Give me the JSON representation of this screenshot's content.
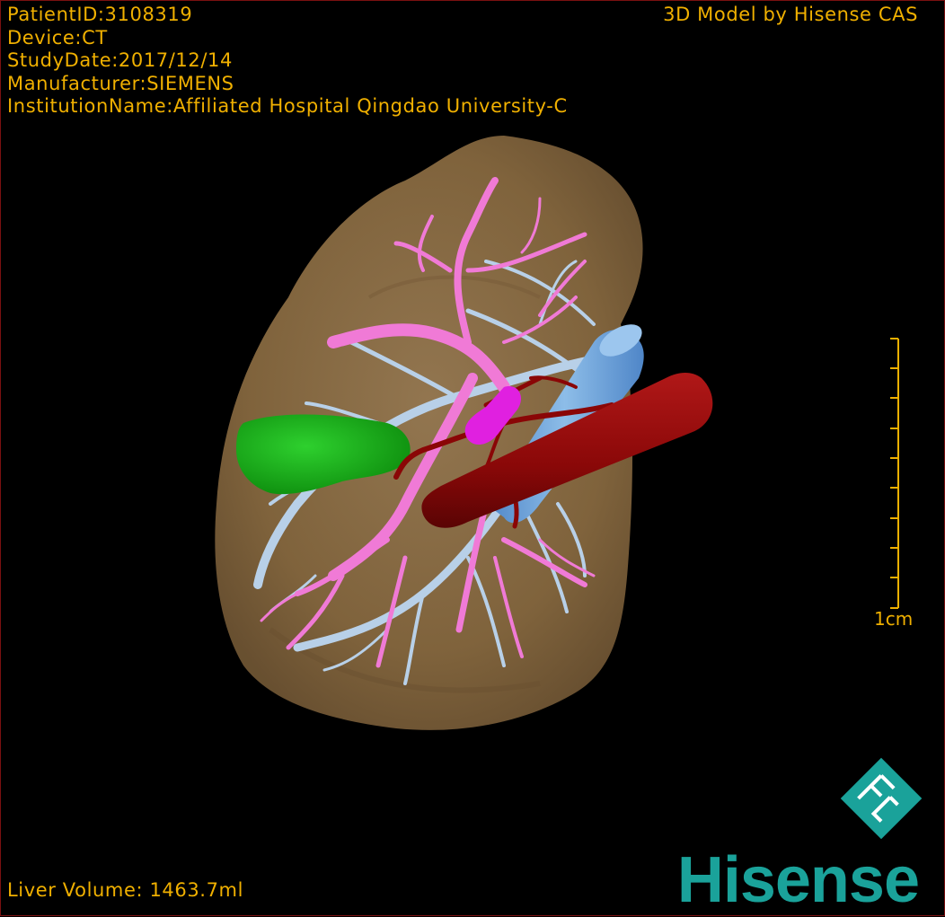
{
  "viewer": {
    "brand_top": "3D Model by Hisense CAS",
    "patient_id": "PatientID:3108319",
    "device": "Device:CT",
    "study_date": "StudyDate:2017/12/14",
    "manufacturer": "Manufacturer:SIEMENS",
    "institution": "InstitutionName:Affiliated Hospital Qingdao University-C",
    "liver_volume": "Liver Volume: 1463.7ml",
    "scale_label": "1cm",
    "logo_text": "Hisense",
    "logo_icon": "hisense-fc-logo-icon"
  },
  "colors": {
    "overlay_text": "#f0b000",
    "liver": "#8a6d48",
    "portal_vein": "#f07ad6",
    "hepatic_vein": "#b8d0e8",
    "gallbladder": "#1fb81f",
    "artery": "#9a0a0a",
    "vena_cava": "#6a9fd8",
    "brand": "#1aa29a"
  }
}
